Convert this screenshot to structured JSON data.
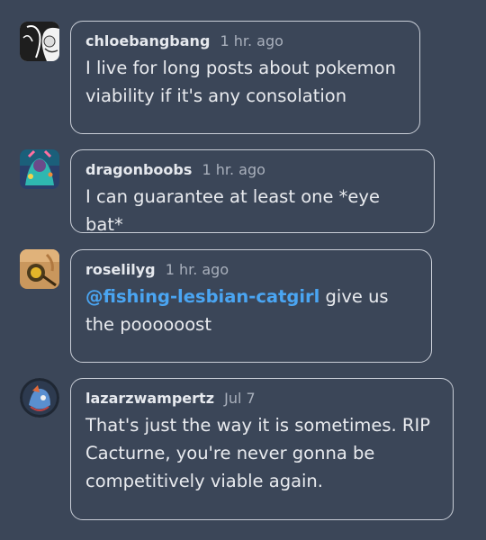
{
  "replies": [
    {
      "username": "chloebangbang",
      "time": "1 hr. ago",
      "text": "I live for long posts about pokemon viability if it's any consolation",
      "avatar_icon": "avatar-chloebangbang"
    },
    {
      "username": "dragonboobs",
      "time": "1 hr. ago",
      "text": "I can guarantee at least one *eye bat*",
      "avatar_icon": "avatar-dragonboobs"
    },
    {
      "username": "roselilyg",
      "time": "1 hr. ago",
      "mention": "@fishing-lesbian-catgirl",
      "text": " give us the poooooost",
      "avatar_icon": "avatar-roselilyg"
    },
    {
      "username": "lazarzwampertz",
      "time": "Jul 7",
      "text": "That's just the way it is sometimes. RIP Cacturne, you're never gonna be competitively viable again.",
      "avatar_icon": "avatar-lazarzwampertz"
    }
  ],
  "colors": {
    "background": "#3b4658",
    "border": "#c9ced7",
    "text": "#e9ebef",
    "meta": "#a9b0bc",
    "mention": "#4aa5f2"
  }
}
